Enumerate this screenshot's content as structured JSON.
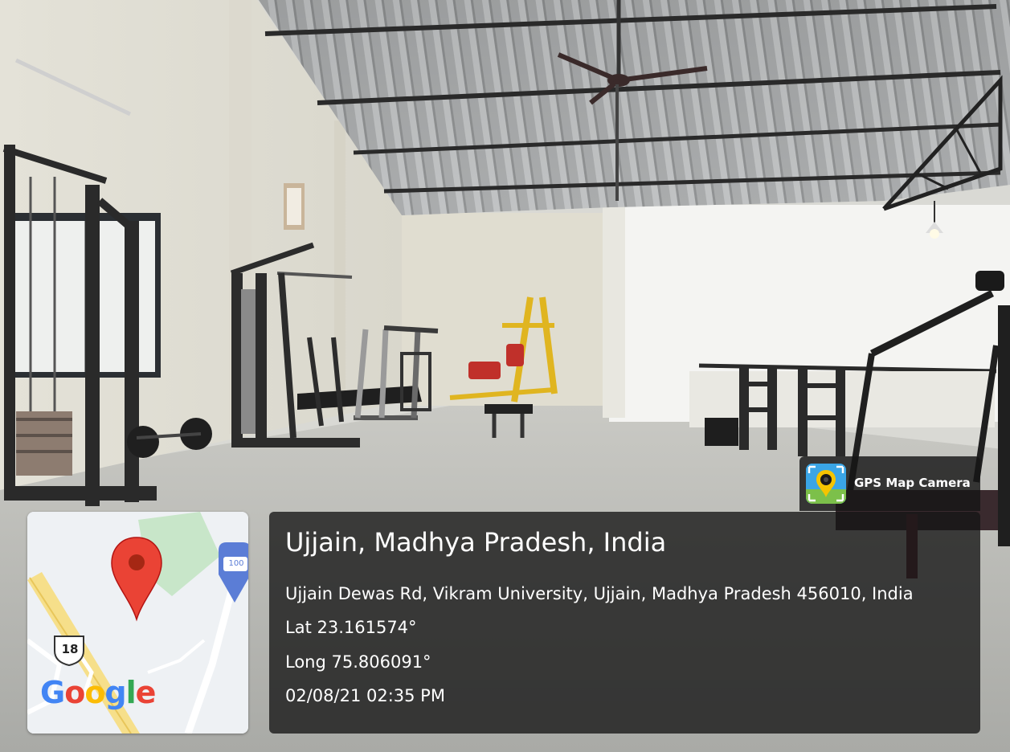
{
  "photo": {
    "scene_icon": "gym-interior-photo"
  },
  "map": {
    "route_shield": "18",
    "poi_badge": "100",
    "logo_text": "Google",
    "marker_color": "#ea4335",
    "park_color": "#c8e6c9"
  },
  "location": {
    "title": "Ujjain, Madhya Pradesh, India",
    "address": "Ujjain Dewas Rd, Vikram University, Ujjain, Madhya Pradesh 456010, India",
    "latitude": "Lat 23.161574°",
    "longitude": "Long 75.806091°",
    "datetime": "02/08/21 02:35 PM"
  },
  "app": {
    "name": "GPS Map Camera",
    "icon": "gps-map-camera-icon"
  }
}
